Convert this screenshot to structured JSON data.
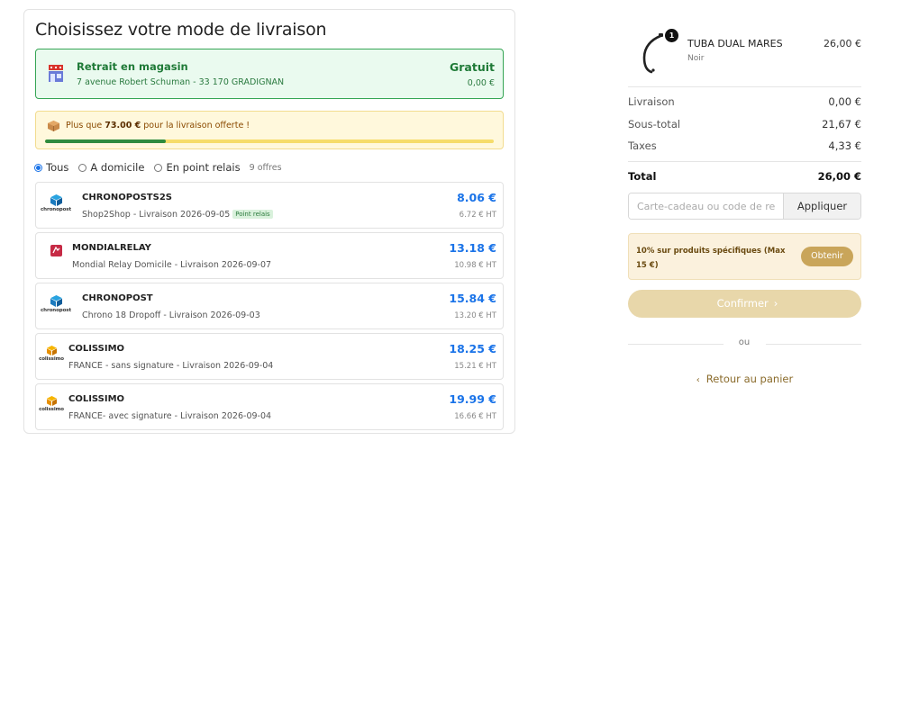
{
  "delivery": {
    "title": "Choisissez votre mode de livraison",
    "store": {
      "name": "Retrait en magasin",
      "address": "7 avenue Robert Schuman - 33 170 GRADIGNAN",
      "label": "Gratuit",
      "price": "0,00 €"
    },
    "promo": {
      "prefix": "Plus que ",
      "amount": "73.00 €",
      "suffix": " pour la livraison offerte !",
      "progress_percent": 27
    },
    "filters": {
      "options": [
        "Tous",
        "A domicile",
        "En point relais"
      ],
      "selected": "Tous",
      "count": "9 offres"
    },
    "carriers": [
      {
        "name": "CHRONOPOSTS2S",
        "description": "Shop2Shop - Livraison 2026-09-05",
        "tag": "Point relais",
        "price": "8.06 €",
        "price_ht": "6.72 € HT",
        "logo": "chronopost-logo",
        "logo_caption": "chronopost"
      },
      {
        "name": "MONDIALRELAY",
        "description": "Mondial Relay Domicile - Livraison 2026-09-07",
        "tag": "",
        "price": "13.18 €",
        "price_ht": "10.98 € HT",
        "logo": "mondialrelay-logo",
        "logo_caption": ""
      },
      {
        "name": "CHRONOPOST",
        "description": "Chrono 18 Dropoff - Livraison 2026-09-03",
        "tag": "",
        "price": "15.84 €",
        "price_ht": "13.20 € HT",
        "logo": "chronopost-logo",
        "logo_caption": "chronopost"
      },
      {
        "name": "COLISSIMO",
        "description": "FRANCE - sans signature - Livraison 2026-09-04",
        "tag": "",
        "price": "18.25 €",
        "price_ht": "15.21 € HT",
        "logo": "colissimo-logo",
        "logo_caption": "colissimo"
      },
      {
        "name": "COLISSIMO",
        "description": "FRANCE- avec signature - Livraison 2026-09-04",
        "tag": "",
        "price": "19.99 €",
        "price_ht": "16.66 € HT",
        "logo": "colissimo-logo",
        "logo_caption": "colissimo"
      }
    ]
  },
  "cart": {
    "product": {
      "quantity": "1",
      "name": "TUBA DUAL MARES",
      "variant": "Noir",
      "price": "26,00 €"
    },
    "summary": {
      "shipping_label": "Livraison",
      "shipping_value": "0,00 €",
      "subtotal_label": "Sous-total",
      "subtotal_value": "21,67 €",
      "taxes_label": "Taxes",
      "taxes_value": "4,33 €",
      "total_label": "Total",
      "total_value": "26,00 €"
    },
    "coupon": {
      "placeholder": "Carte-cadeau ou code de re",
      "apply_label": "Appliquer"
    },
    "offer": {
      "text": "10% sur produits spécifiques (Max 15 €)",
      "button_label": "Obtenir"
    },
    "confirm_label": "Confirmer",
    "confirm_chevron": "›",
    "or_label": "ou",
    "back_label": "Retour au panier",
    "back_chevron": "‹"
  },
  "colors": {
    "accent_blue": "#1a73e8",
    "store_green": "#35a554",
    "gold": "#c9a55a",
    "confirm_disabled": "#e8d7aa"
  }
}
